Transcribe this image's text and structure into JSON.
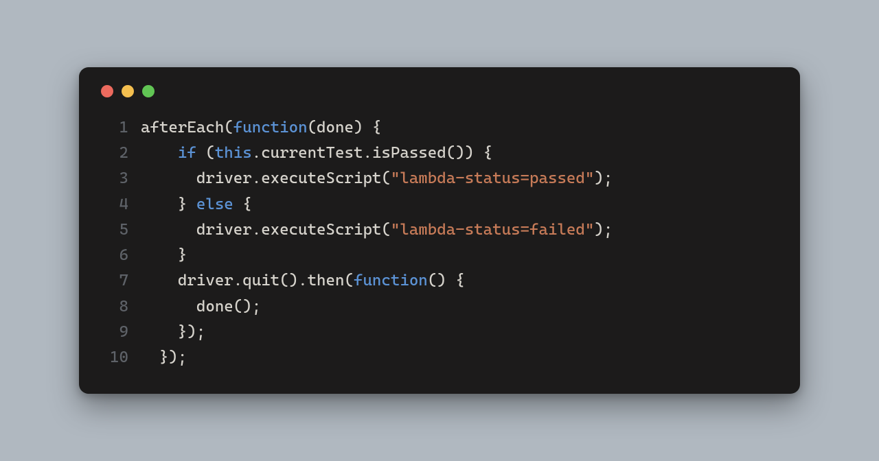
{
  "window": {
    "traffic_lights": [
      "red",
      "yellow",
      "green"
    ]
  },
  "code": {
    "lines": [
      {
        "n": "1",
        "tokens": [
          {
            "t": "afterEach(",
            "c": "pn"
          },
          {
            "t": "function",
            "c": "kw"
          },
          {
            "t": "(done) {",
            "c": "pn"
          }
        ]
      },
      {
        "n": "2",
        "tokens": [
          {
            "t": "    ",
            "c": "pn"
          },
          {
            "t": "if",
            "c": "kw"
          },
          {
            "t": " (",
            "c": "pn"
          },
          {
            "t": "this",
            "c": "kw"
          },
          {
            "t": ".currentTest.isPassed()) {",
            "c": "pn"
          }
        ]
      },
      {
        "n": "3",
        "tokens": [
          {
            "t": "      driver.executeScript(",
            "c": "pn"
          },
          {
            "t": "\"lambda-status=passed\"",
            "c": "str"
          },
          {
            "t": ");",
            "c": "pn"
          }
        ]
      },
      {
        "n": "4",
        "tokens": [
          {
            "t": "    } ",
            "c": "pn"
          },
          {
            "t": "else",
            "c": "kw"
          },
          {
            "t": " {",
            "c": "pn"
          }
        ]
      },
      {
        "n": "5",
        "tokens": [
          {
            "t": "      driver.executeScript(",
            "c": "pn"
          },
          {
            "t": "\"lambda-status=failed\"",
            "c": "str"
          },
          {
            "t": ");",
            "c": "pn"
          }
        ]
      },
      {
        "n": "6",
        "tokens": [
          {
            "t": "    }",
            "c": "pn"
          }
        ]
      },
      {
        "n": "7",
        "tokens": [
          {
            "t": "    driver.quit().then(",
            "c": "pn"
          },
          {
            "t": "function",
            "c": "kw"
          },
          {
            "t": "() {",
            "c": "pn"
          }
        ]
      },
      {
        "n": "8",
        "tokens": [
          {
            "t": "      done();",
            "c": "pn"
          }
        ]
      },
      {
        "n": "9",
        "tokens": [
          {
            "t": "    });",
            "c": "pn"
          }
        ]
      },
      {
        "n": "10",
        "tokens": [
          {
            "t": "  });",
            "c": "pn"
          }
        ]
      }
    ]
  }
}
